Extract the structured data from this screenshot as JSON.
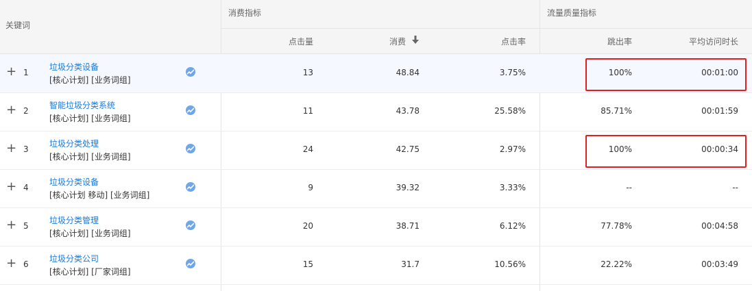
{
  "header": {
    "keyword": "关键词",
    "group_cost": "消费指标",
    "group_traffic": "流量质量指标",
    "clicks": "点击量",
    "cost": "消费",
    "ctr": "点击率",
    "bounce": "跳出率",
    "avg_time": "平均访问时长",
    "sort_icon": "arrow-down-icon"
  },
  "rows": [
    {
      "index": "1",
      "keyword": "垃圾分类设备",
      "tags": "[核心计划]  [业务词组]",
      "clicks": "13",
      "cost": "48.84",
      "ctr": "3.75%",
      "bounce": "100%",
      "avg_time": "00:01:00",
      "highlighted": true
    },
    {
      "index": "2",
      "keyword": "智能垃圾分类系统",
      "tags": "[核心计划]  [业务词组]",
      "clicks": "11",
      "cost": "43.78",
      "ctr": "25.58%",
      "bounce": "85.71%",
      "avg_time": "00:01:59",
      "highlighted": false
    },
    {
      "index": "3",
      "keyword": "垃圾分类处理",
      "tags": "[核心计划]  [业务词组]",
      "clicks": "24",
      "cost": "42.75",
      "ctr": "2.97%",
      "bounce": "100%",
      "avg_time": "00:00:34",
      "highlighted": true
    },
    {
      "index": "4",
      "keyword": "垃圾分类设备",
      "tags": "[核心计划 移动]  [业务词组]",
      "clicks": "9",
      "cost": "39.32",
      "ctr": "3.33%",
      "bounce": "--",
      "avg_time": "--",
      "highlighted": false
    },
    {
      "index": "5",
      "keyword": "垃圾分类管理",
      "tags": "[核心计划]  [业务词组]",
      "clicks": "20",
      "cost": "38.71",
      "ctr": "6.12%",
      "bounce": "77.78%",
      "avg_time": "00:04:58",
      "highlighted": false
    },
    {
      "index": "6",
      "keyword": "垃圾分类公司",
      "tags": "[核心计划]  [厂家词组]",
      "clicks": "15",
      "cost": "31.7",
      "ctr": "10.56%",
      "bounce": "22.22%",
      "avg_time": "00:03:49",
      "highlighted": false
    }
  ],
  "colors": {
    "link": "#1e78d8",
    "highlight_box": "#e02020",
    "header_bg": "#f5f5f5",
    "trend_icon": "#6fa6ea"
  },
  "icons": {
    "expand": "plus-icon",
    "trend": "trend-chart-icon"
  }
}
